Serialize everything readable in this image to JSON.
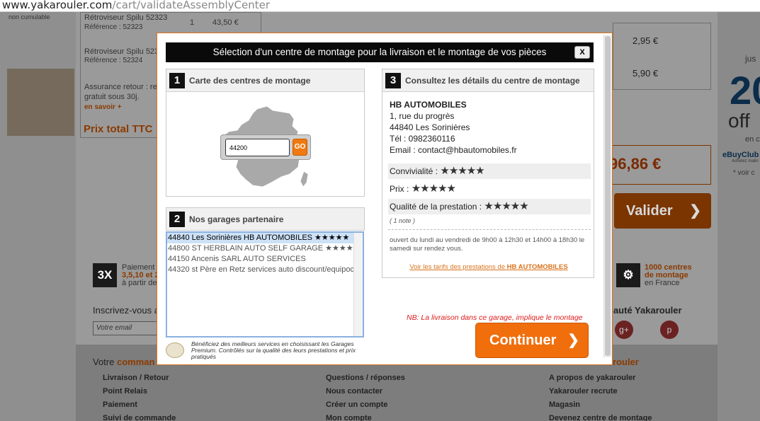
{
  "browser": {
    "url_host": "www.yakarouler.com",
    "url_path": "/cart/validateAssemblyCenter"
  },
  "background": {
    "item_label_top": "non cumulable",
    "item1_name": "Rétroviseur Spilu 52323",
    "item1_ref": "Référence : 52323",
    "item1_qty": "1",
    "item1_price": "43,50 €",
    "item2_name": "Rétroviseur Spilu 52324",
    "item2_ref": "Référence : 52324",
    "insurance_line1": "Assurance retour : re",
    "insurance_line2": "gratuit sous 30j.",
    "insurance_link": "en savoir +",
    "total_label": "Prix total TTC",
    "price_a": "2,95 €",
    "price_b": "5,90 €",
    "grand_total": "96,86 €",
    "validate_label": "Valider",
    "pay_badge": "3X",
    "pay_line1": "Paiement e",
    "pay_line2": "3,5,10 et 2",
    "pay_line3": "à partir de",
    "centers_line1": "1000 centres",
    "centers_line2": "de montage",
    "centers_line3": "en France",
    "newsletter_label": "Inscrivez-vous a",
    "email_placeholder": "Votre email",
    "community_label": "nauté Yakarouler",
    "footer_col1_title_a": "Votre ",
    "footer_col1_title_b": "comman",
    "footer_col1": [
      "Livraison / Retour",
      "Point Relais",
      "Paiement",
      "Suivi de commande"
    ],
    "footer_col2": [
      "Questions / réponses",
      "Nous contacter",
      "Créer un compte",
      "Mon compte"
    ],
    "footer_col3_title": "rouler",
    "footer_col3": [
      "A propos de yakarouler",
      "Yakarouler recrute",
      "Magasin",
      "Devenez centre de montage"
    ],
    "ad_line1": "jus",
    "ad_big": "20",
    "ad_line2": "off",
    "ad_line3": "en ca",
    "ad_brand": "eBuyClub",
    "ad_sub": "Achetez malin",
    "ad_link": "* voir c"
  },
  "modal": {
    "title": "Sélection d'un centre de montage pour la livraison et le montage de vos pièces",
    "close_label": "X",
    "step1_num": "1",
    "step1_title": "Carte des centres de montage",
    "zip_value": "44200",
    "go_label": "GO",
    "step2_num": "2",
    "step2_title": "Nos garages partenaire",
    "garages": [
      "44840 Les Sorinières HB AUTOMOBILES ★★★★★",
      "44800 ST HERBLAIN AUTO SELF GARAGE ★★★★☆",
      "44150 Ancenis SARL AUTO SERVICES",
      "44320 st Père en Retz services auto discount/equipoc"
    ],
    "premium_text": "Bénéficiez des meilleurs services en choisissant les Garages Premium. Contrôlés sur la qualité des leurs prestations et prix pratiqués",
    "step3_num": "3",
    "step3_title": "Consultez les détails du centre de montage",
    "center": {
      "name": "HB AUTOMOBILES",
      "street": "1, rue du progrès",
      "city": "44840 Les Sorinières",
      "phone": "Tél : 0982360116",
      "email": "Email : contact@hbautomobiles.fr"
    },
    "ratings": [
      {
        "label": "Convivialité :",
        "stars": 5,
        "glyphs": "★★★★★"
      },
      {
        "label": "Prix :",
        "stars": 5,
        "glyphs": "★★★★★"
      },
      {
        "label": "Qualité de la prestation :",
        "stars": 5,
        "glyphs": "★★★★★"
      }
    ],
    "note_count": "( 1 note )",
    "hours": "ouvert du lundi au vendredi de 9h00 à 12h30 et 14h00 à 18h30 le samedi sur rendez vous.",
    "tarifs_prefix": "Voir les tarifs des prestations de ",
    "tarifs_name": "HB AUTOMOBILES",
    "nb_text": "NB: La livraison dans ce garage, implique le montage",
    "continue_label": "Continuer",
    "continue_chevron": "❯"
  }
}
